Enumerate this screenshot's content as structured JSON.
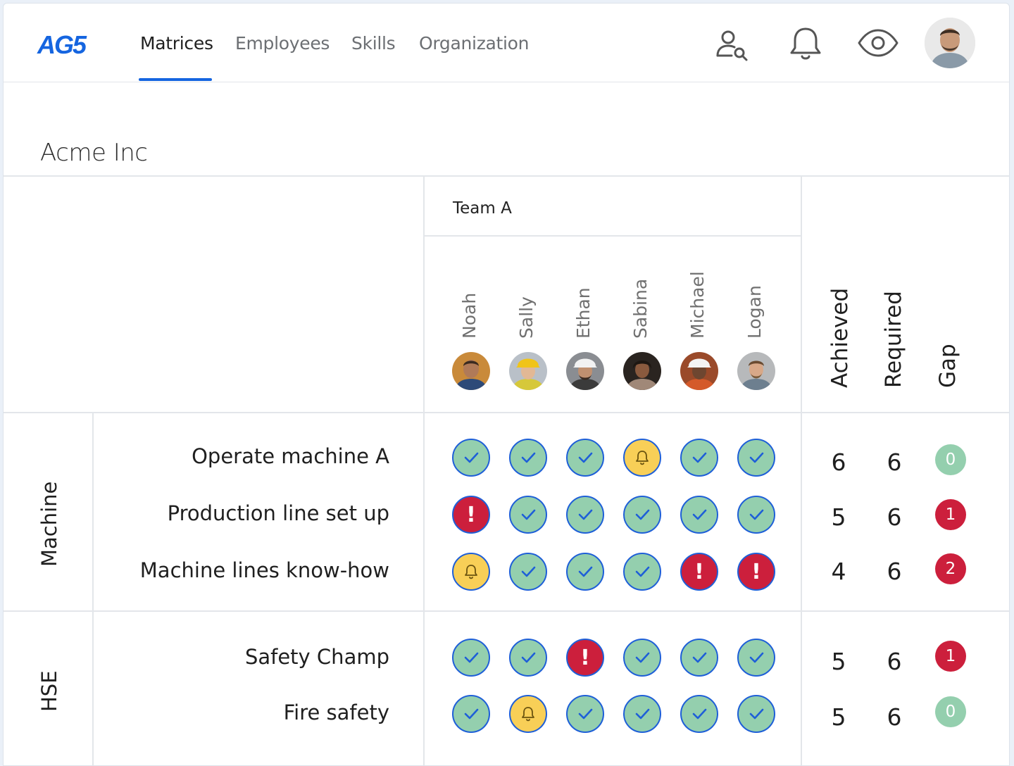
{
  "app": {
    "logo": "AG5"
  },
  "nav": {
    "tabs": [
      {
        "label": "Matrices",
        "active": true
      },
      {
        "label": "Employees",
        "active": false
      },
      {
        "label": "Skills",
        "active": false
      },
      {
        "label": "Organization",
        "active": false
      }
    ],
    "icons": [
      "user-search-icon",
      "bell-icon",
      "eye-icon",
      "avatar"
    ]
  },
  "page": {
    "title": "Acme Inc"
  },
  "team": {
    "name": "Team A"
  },
  "employees": [
    "Noah",
    "Sally",
    "Ethan",
    "Sabina",
    "Michael",
    "Logan"
  ],
  "stats_headers": {
    "achieved": "Achieved",
    "required": "Required",
    "gap": "Gap"
  },
  "groups": [
    {
      "name": "Machine",
      "skills": [
        {
          "name": "Operate machine A",
          "cells": [
            "ok",
            "ok",
            "ok",
            "warn",
            "ok",
            "ok"
          ],
          "achieved": "6",
          "required": "6",
          "gap": "0"
        },
        {
          "name": "Production line set up",
          "cells": [
            "bad",
            "ok",
            "ok",
            "ok",
            "ok",
            "ok"
          ],
          "achieved": "5",
          "required": "6",
          "gap": "1"
        },
        {
          "name": "Machine lines know-how",
          "cells": [
            "warn",
            "ok",
            "ok",
            "ok",
            "bad",
            "bad"
          ],
          "achieved": "4",
          "required": "6",
          "gap": "2"
        }
      ]
    },
    {
      "name": "HSE",
      "skills": [
        {
          "name": "Safety Champ",
          "cells": [
            "ok",
            "ok",
            "bad",
            "ok",
            "ok",
            "ok"
          ],
          "achieved": "5",
          "required": "6",
          "gap": "1"
        },
        {
          "name": "Fire safety",
          "cells": [
            "ok",
            "warn",
            "ok",
            "ok",
            "ok",
            "ok"
          ],
          "achieved": "5",
          "required": "6",
          "gap": "0"
        }
      ]
    }
  ],
  "colors": {
    "accent": "#1565e0",
    "achieved": "#94cfae",
    "warning": "#f8cf57",
    "missing": "#cc1f3c"
  }
}
